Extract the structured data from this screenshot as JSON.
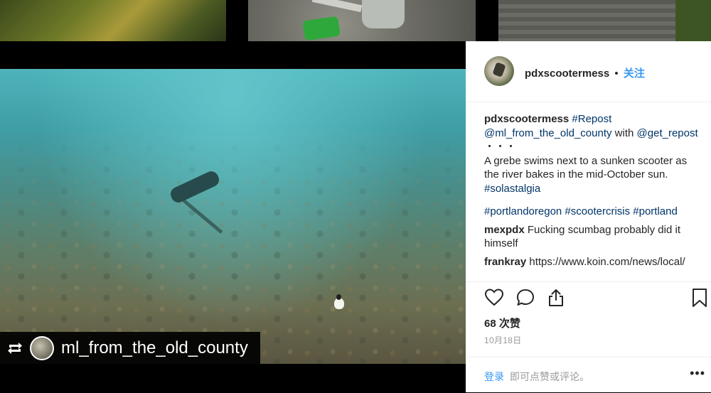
{
  "post": {
    "author": "pdxscootermess",
    "separator": "•",
    "follow_label": "关注",
    "caption": {
      "username": "pdxscootermess",
      "repost_tag": "#Repost",
      "mention1": "@ml_from_the_old_county",
      "with_word": "with",
      "mention2": "@get_repost",
      "dots": "・・・",
      "body_line1": "A grebe swims next to a sunken scooter as",
      "body_line2": "the river bakes in the mid-October sun.",
      "tag1": "#solastalgia",
      "tags_line": "#portlandoregon #scootercrisis #portland"
    },
    "comments": [
      {
        "username": "mexpdx",
        "text_line1": "Fucking scumbag probably did it",
        "text_line2": "himself"
      },
      {
        "username": "frankray",
        "text_line1": "https://www.koin.com/news/local/"
      }
    ],
    "likes": "68 次赞",
    "date": "10月18日"
  },
  "repost_badge": {
    "username": "ml_from_the_old_county"
  },
  "login_bar": {
    "login_label": "登录",
    "prompt": "即可点赞或评论。",
    "more": "•••"
  },
  "colors": {
    "link_blue": "#3897f0",
    "hashtag_navy": "#003569",
    "text_dark": "#262626",
    "muted_gray": "#999999"
  },
  "icons": [
    "heart-icon",
    "comment-icon",
    "share-icon",
    "bookmark-icon",
    "repost-icon",
    "more-icon"
  ]
}
